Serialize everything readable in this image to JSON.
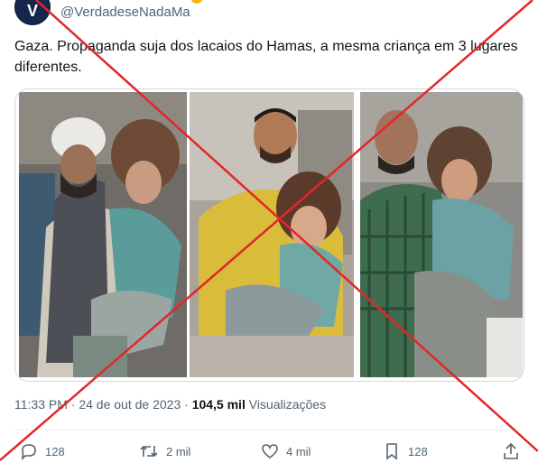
{
  "author": {
    "avatar_letter": "V",
    "handle": "@VerdadeseNadaMa"
  },
  "tweet": {
    "text": "Gaza. Propaganda suja dos lacaios do Hamas, a mesma criança em 3 lugares diferentes.",
    "photos": [
      {
        "name": "rescuer-white-helmet-carrying-girl"
      },
      {
        "name": "man-yellow-shirt-carrying-girl"
      },
      {
        "name": "man-plaid-shirt-carrying-girl"
      }
    ]
  },
  "meta": {
    "time": "11:33 PM",
    "separator": "·",
    "date": "24 de out de 2023",
    "views_count": "104,5 mil",
    "views_label": "Visualizações"
  },
  "actions": {
    "replies": "128",
    "retweets": "2 mil",
    "likes": "4 mil",
    "bookmarks": "128"
  },
  "overlay": {
    "type": "red-x-mark",
    "color": "#e3262b"
  },
  "colors": {
    "text": "#0f1419",
    "secondary": "#536471",
    "border": "#cfd9de"
  }
}
